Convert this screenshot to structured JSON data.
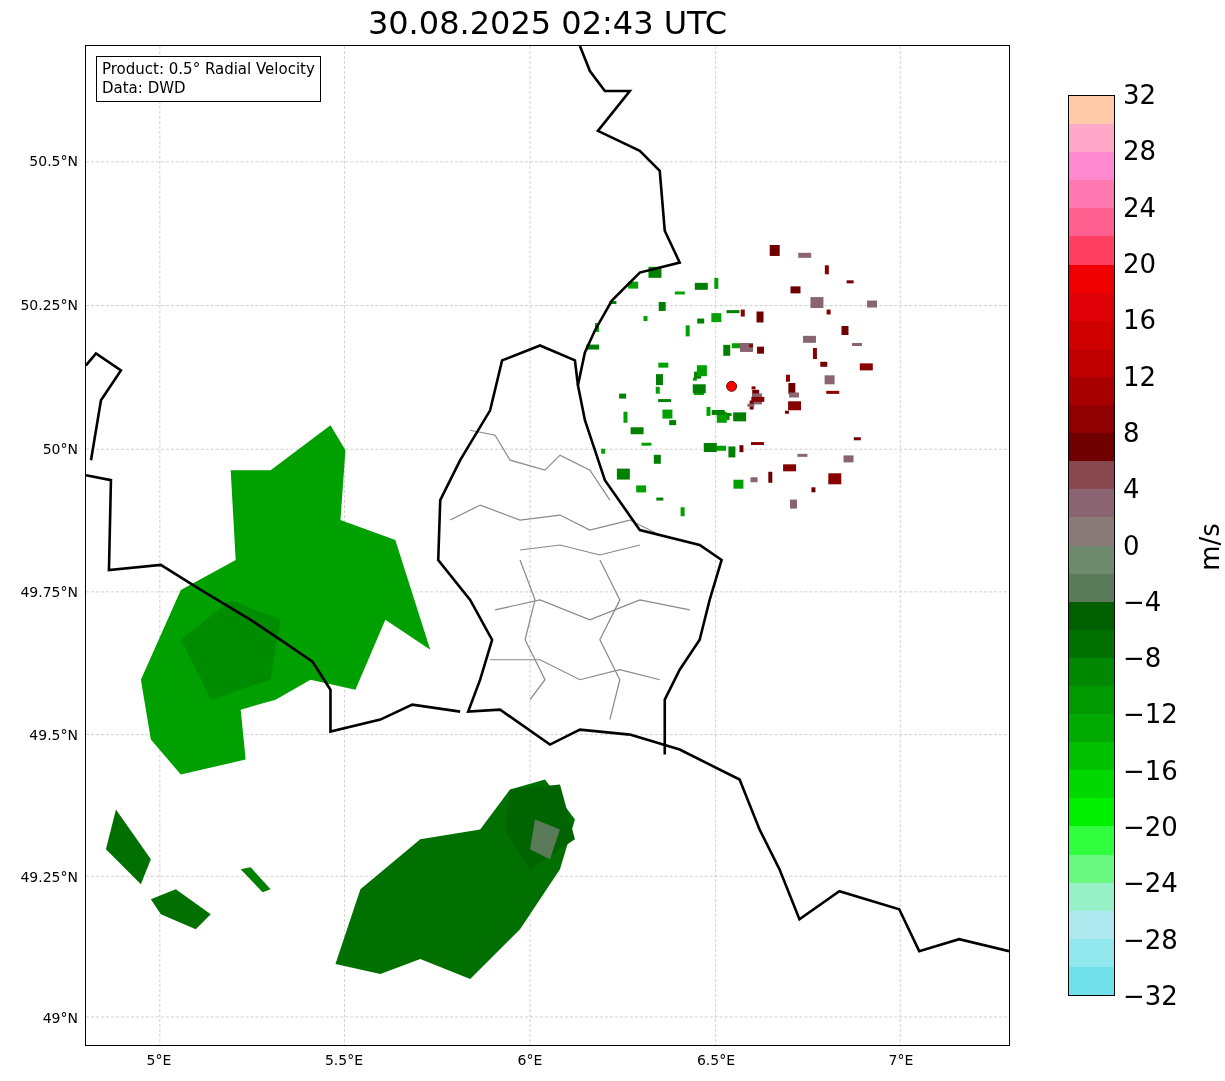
{
  "title": "30.08.2025 02:43 UTC",
  "legend": [
    "Product: 0.5° Radial Velocity",
    "Data: DWD"
  ],
  "lat_ticks": [
    "50.5°N",
    "50.25°N",
    "50°N",
    "49.75°N",
    "49.5°N",
    "49.25°N",
    "49°N"
  ],
  "lon_ticks": [
    "5°E",
    "5.5°E",
    "6°E",
    "6.5°E",
    "7°E"
  ],
  "colorbar": {
    "label": "m/s",
    "ticks": [
      "32",
      "28",
      "24",
      "20",
      "16",
      "12",
      "8",
      "4",
      "0",
      "−4",
      "−8",
      "−12",
      "−16",
      "−20",
      "−24",
      "−28",
      "−32"
    ],
    "segments": [
      {
        "color": "#ffcbab"
      },
      {
        "color": "#ffa8c8"
      },
      {
        "color": "#ff88d0"
      },
      {
        "color": "#ff78b0"
      },
      {
        "color": "#ff6090"
      },
      {
        "color": "#ff4060"
      },
      {
        "color": "#f00000"
      },
      {
        "color": "#e00008"
      },
      {
        "color": "#d00000"
      },
      {
        "color": "#c00000"
      },
      {
        "color": "#a80000"
      },
      {
        "color": "#900000"
      },
      {
        "color": "#700000"
      },
      {
        "color": "#884850"
      },
      {
        "color": "#8a6470"
      },
      {
        "color": "#8a7a78"
      },
      {
        "color": "#6e8a6e"
      },
      {
        "color": "#5a7a5a"
      },
      {
        "color": "#006000"
      },
      {
        "color": "#007000"
      },
      {
        "color": "#008800"
      },
      {
        "color": "#009a00"
      },
      {
        "color": "#00aa00"
      },
      {
        "color": "#00c000"
      },
      {
        "color": "#00d800"
      },
      {
        "color": "#00f000"
      },
      {
        "color": "#30ff40"
      },
      {
        "color": "#68f880"
      },
      {
        "color": "#98f0c8"
      },
      {
        "color": "#b0e8f0"
      },
      {
        "color": "#90e8ec"
      },
      {
        "color": "#70e0e8"
      }
    ]
  }
}
